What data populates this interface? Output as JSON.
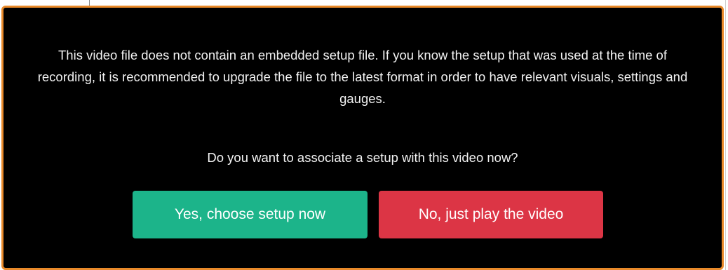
{
  "dialog": {
    "message": "This video file does not contain an embedded setup file. If you know the setup that was used at the time of recording, it is recommended to upgrade the file to the latest format in order to have relevant visuals, settings and gauges.",
    "question": "Do you want to associate a setup with this video now?",
    "yes_label": "Yes, choose setup now",
    "no_label": "No, just play the video"
  },
  "colors": {
    "dialog_background": "#000000",
    "dialog_border": "#e98a2a",
    "yes_button": "#1cb48a",
    "no_button": "#dc3545",
    "text": "#f2f2f2"
  }
}
